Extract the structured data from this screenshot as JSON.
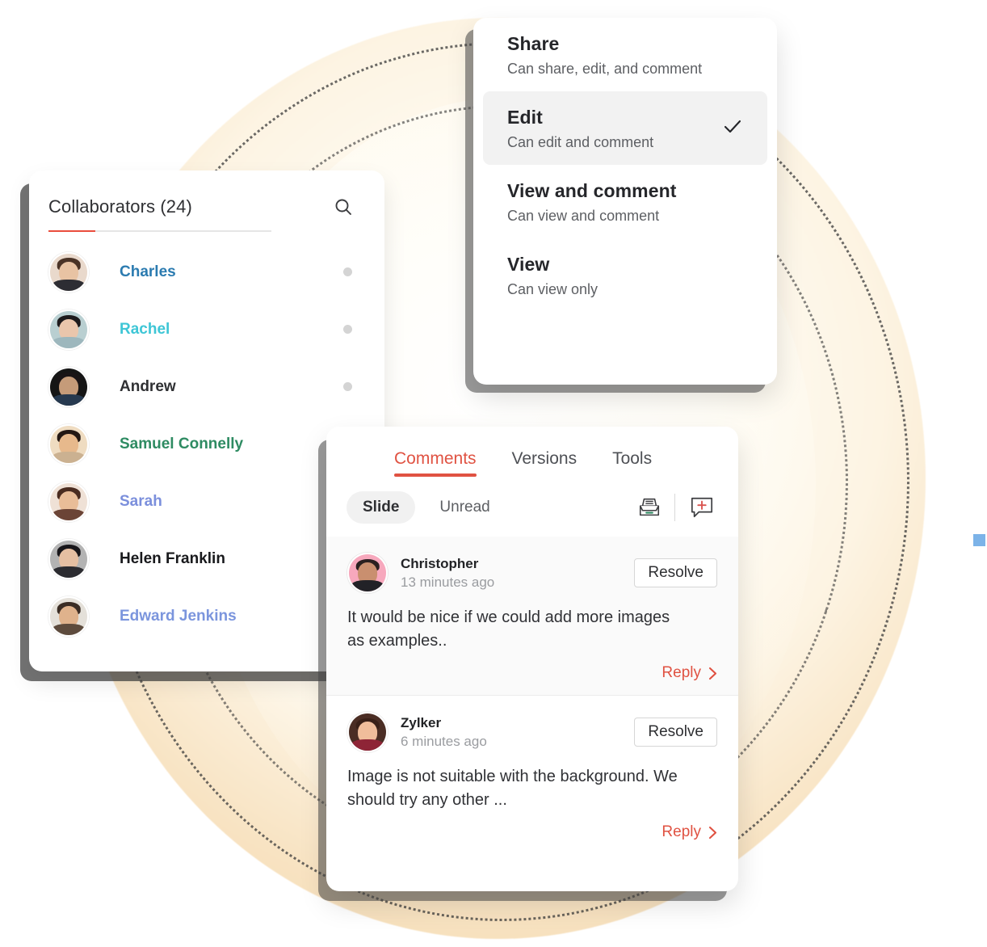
{
  "theme": {
    "accent_red": "#e05242",
    "accent_underline": "#ea4d3d",
    "status_dot": "#d4d4d4",
    "blue_chip": "#7cb3e8"
  },
  "collaborators_panel": {
    "title": "Collaborators (24)",
    "search_icon": "search-icon",
    "items": [
      {
        "name": "Charles",
        "color": "#2b7bb0",
        "has_status_dot": true,
        "avatar": {
          "bg": "#e9d9cc",
          "hair": "#4a3326",
          "skin": "#e8c3a3",
          "body": "#2d2d33"
        }
      },
      {
        "name": "Rachel",
        "color": "#3ec6d6",
        "has_status_dot": true,
        "avatar": {
          "bg": "#b9cfd1",
          "hair": "#1d1a1c",
          "skin": "#eac6ac",
          "body": "#9db7bd"
        }
      },
      {
        "name": "Andrew",
        "color": "#2f3033",
        "has_status_dot": true,
        "avatar": {
          "bg": "#151515",
          "hair": "#191416",
          "skin": "#c59b79",
          "body": "#26394f"
        }
      },
      {
        "name": "Samuel Connelly",
        "color": "#2e8b62",
        "has_status_dot": false,
        "avatar": {
          "bg": "#efdcc1",
          "hair": "#241813",
          "skin": "#e7b98c",
          "body": "#cbb191"
        }
      },
      {
        "name": "Sarah",
        "color": "#7b8fdc",
        "has_status_dot": false,
        "avatar": {
          "bg": "#efe1d6",
          "hair": "#4a2c20",
          "skin": "#e9bd98",
          "body": "#6b4436"
        }
      },
      {
        "name": "Helen Franklin",
        "color": "#18191c",
        "has_status_dot": false,
        "avatar": {
          "bg": "#b3b3b3",
          "hair": "#18161a",
          "skin": "#e5bfa2",
          "body": "#2b2b30"
        }
      },
      {
        "name": "Edward Jenkins",
        "color": "#7b95dd",
        "has_status_dot": false,
        "avatar": {
          "bg": "#e4e0d9",
          "hair": "#3a2c24",
          "skin": "#dfb28c",
          "body": "#5d4b3d"
        }
      }
    ]
  },
  "share_panel": {
    "options": [
      {
        "title": "Share",
        "subtitle": "Can share, edit, and comment",
        "selected": false
      },
      {
        "title": "Edit",
        "subtitle": "Can edit and comment",
        "selected": true
      },
      {
        "title": "View and comment",
        "subtitle": "Can view and comment",
        "selected": false
      },
      {
        "title": "View",
        "subtitle": "Can view only",
        "selected": false
      }
    ],
    "check_icon": "check-icon"
  },
  "comments_panel": {
    "tabs": [
      {
        "label": "Comments",
        "active": true
      },
      {
        "label": "Versions",
        "active": false
      },
      {
        "label": "Tools",
        "active": false
      }
    ],
    "filters": [
      {
        "label": "Slide",
        "active": true
      },
      {
        "label": "Unread",
        "active": false
      }
    ],
    "actions": [
      {
        "name": "archive-tray-icon"
      },
      {
        "name": "add-comment-icon"
      }
    ],
    "comments": [
      {
        "author": "Christopher",
        "time": "13 minutes ago",
        "text": "It would be nice if we could add more images as examples..",
        "resolve_label": "Resolve",
        "reply_label": "Reply",
        "tinted": true,
        "avatar": {
          "bg": "#f7a8bd",
          "hair": "#2a2020",
          "skin": "#c98f6f",
          "body": "#222227"
        }
      },
      {
        "author": "Zylker",
        "time": "6 minutes ago",
        "text": "Image is not suitable with the background. We should try any other ...",
        "resolve_label": "Resolve",
        "reply_label": "Reply",
        "tinted": false,
        "avatar": {
          "bg": "#4b2d24",
          "hair": "#3a2018",
          "skin": "#f0bd9b",
          "body": "#8e2436"
        }
      }
    ]
  }
}
